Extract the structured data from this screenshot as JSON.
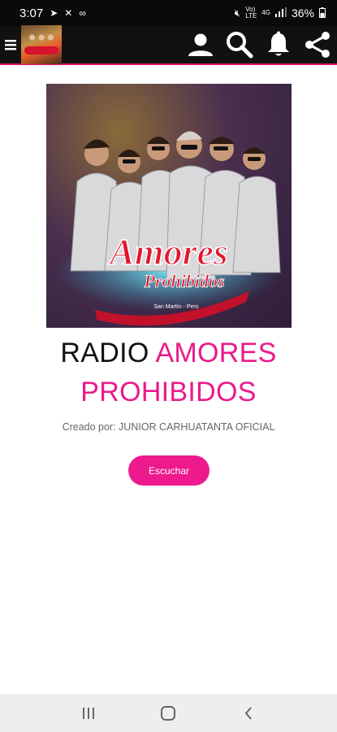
{
  "status_bar": {
    "time": "3:07",
    "battery": "36%",
    "network_top": "Vo)",
    "network_bottom": "LTE",
    "network_4g": "4G"
  },
  "app_bar": {
    "icons": [
      "menu-icon",
      "account-icon",
      "search-icon",
      "bell-icon",
      "share-icon"
    ]
  },
  "station": {
    "title_prefix": "RADIO",
    "title_highlight": "AMORES PROHIBIDOS",
    "creator": "Creado por: JUNIOR CARHUATANTA OFICIAL",
    "listen_label": "Escuchar",
    "cover_logo_line1": "Amores",
    "cover_logo_line2": "Prohibidos",
    "cover_logo_line3": "San Martín - Perú"
  },
  "colors": {
    "accent": "#ec1a8c",
    "appbar": "#111111",
    "divider": "#e2156b"
  }
}
